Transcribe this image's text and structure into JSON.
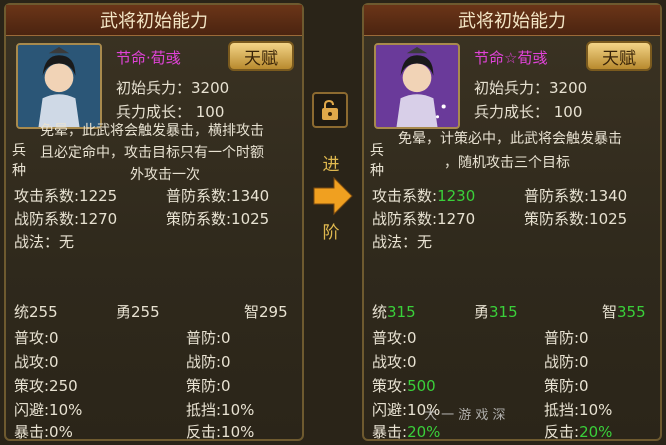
{
  "left": {
    "title": "武将初始能力",
    "hero_name": "节命·荀彧",
    "talent_label": "天赋",
    "initial_troops": "初始兵力：3200",
    "troop_growth": "兵力成长： 100",
    "skill_type_top": "兵",
    "skill_type_bottom": "种",
    "skill_desc_line1": "免晕，此武将会触发暴击，横排攻击",
    "skill_desc_line2": "且必定命中，攻击目标只有一个时额",
    "skill_desc_line3": "外攻击一次",
    "attack_coef": "攻击系数:1225",
    "normal_def_coef": "普防系数:1340",
    "battle_def_coef": "战防系数:1270",
    "strategy_def_coef": "策防系数:1025",
    "tactic": "战法：无",
    "command_label": "统",
    "command_value": "255",
    "valor_label": "勇",
    "valor_value": "255",
    "wisdom_label": "智",
    "wisdom_value": "295",
    "normal_atk": "普攻:0",
    "normal_def": "普防:0",
    "battle_atk": "战攻:0",
    "battle_def": "战防:0",
    "strategy_atk": "策攻:250",
    "strategy_def": "策防:0",
    "dodge": "闪避:10%",
    "block": "抵挡:10%",
    "crit": "暴击:0%",
    "counter": "反击:10%"
  },
  "right": {
    "title": "武将初始能力",
    "hero_name": "节命☆荀彧",
    "talent_label": "天赋",
    "initial_troops": "初始兵力：3200",
    "troop_growth": "兵力成长： 100",
    "skill_type_top": "兵",
    "skill_type_bottom": "种",
    "skill_desc_line1": "免晕，计策必中，此武将会触发暴击",
    "skill_desc_line2": "，随机攻击三个目标",
    "attack_coef_label": "攻击系数:",
    "attack_coef_value": "1230",
    "normal_def_coef": "普防系数:1340",
    "battle_def_coef": "战防系数:1270",
    "strategy_def_coef": "策防系数:1025",
    "tactic": "战法：无",
    "command_label": "统",
    "command_value": "315",
    "valor_label": "勇",
    "valor_value": "315",
    "wisdom_label": "智",
    "wisdom_value": "355",
    "normal_atk": "普攻:0",
    "normal_def": "普防:0",
    "battle_atk": "战攻:0",
    "battle_def": "战防:0",
    "strategy_atk_label": "策攻:",
    "strategy_atk_value": "500",
    "strategy_def": "策防:0",
    "dodge": "闪避:10%",
    "block": "抵挡:10%",
    "crit_label": "暴击:",
    "crit_value": "20%",
    "counter_label": "反击:",
    "counter_value": "20%"
  },
  "center": {
    "lock_icon": "unlock-icon",
    "advance_top": "进",
    "advance_bottom": "阶",
    "arrow_color": "#f0a020"
  },
  "watermark": "大 一 游 戏 深"
}
